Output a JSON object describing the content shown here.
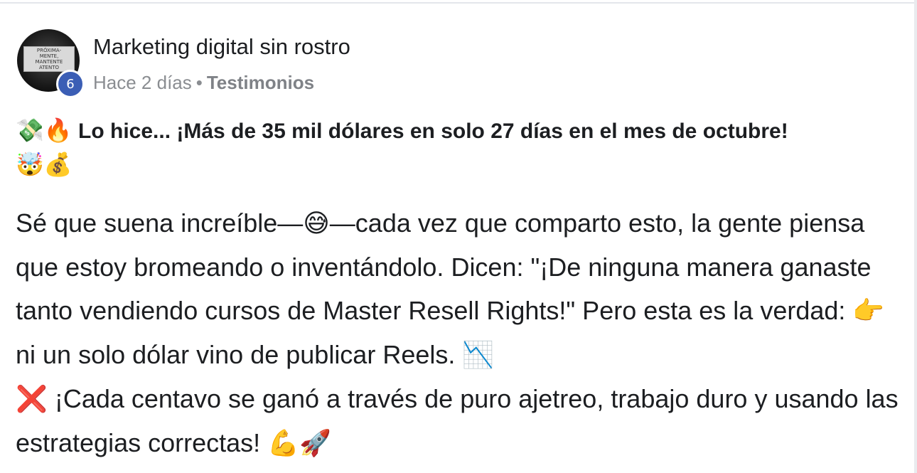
{
  "post": {
    "group_name": "Marketing digital sin rostro",
    "badge_count": "6",
    "time": "Hace 2 días",
    "separator": "•",
    "topic": "Testimonios",
    "avatar_sign": "PRÓXIMA-\nMENTE,\nMANTENTE\nATENTO"
  },
  "headline": {
    "emoji_lead_1": "💸",
    "emoji_lead_2": "🔥",
    "text": "Lo hice... ¡Más de 35 mil dólares en solo 27 días en el mes de octubre!",
    "emoji_trail_1": "🤯",
    "emoji_trail_2": "💰"
  },
  "body": {
    "part1": "Sé que suena increíble—",
    "emoji_sweat": "😅",
    "part2": "—cada vez que comparto esto, la gente piensa que estoy bromeando o inventándolo. Dicen: \"¡De ninguna manera ganaste tanto vendiendo cursos de Master Resell Rights!\" Pero esta es la verdad: ",
    "emoji_point": "👉",
    "part3": " ni un solo dólar vino de publicar Reels. ",
    "emoji_chart": "📉",
    "emoji_x": "❌",
    "part4": " ¡Cada centavo se ganó a través de puro ajetreo, trabajo duro y usando las estrategias correctas! ",
    "emoji_muscle": "💪",
    "emoji_rocket": "🚀"
  }
}
